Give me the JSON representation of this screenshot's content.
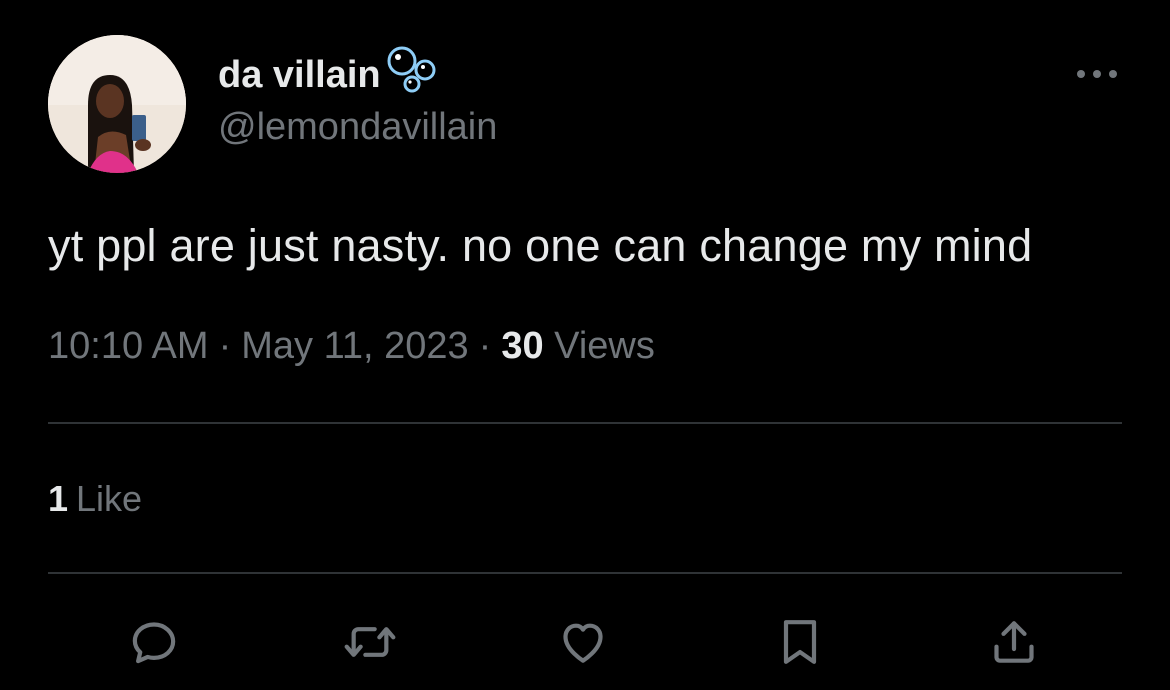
{
  "author": {
    "display_name": "da villain",
    "handle": "@lemondavillain",
    "avatar": "profile-photo",
    "name_emoji": "bubbles-icon"
  },
  "tweet": {
    "text": "yt ppl are just nasty. no one can change my mind",
    "time": "10:10 AM",
    "separator": "·",
    "date": "May 11, 2023",
    "views_count": "30",
    "views_label": "Views"
  },
  "engagement": {
    "likes_count": "1",
    "likes_label": "Like"
  },
  "actions": [
    {
      "icon": "reply-icon"
    },
    {
      "icon": "retweet-icon"
    },
    {
      "icon": "heart-icon"
    },
    {
      "icon": "bookmark-icon"
    },
    {
      "icon": "share-icon"
    }
  ],
  "colors": {
    "background": "#000000",
    "primary_text": "#e7e9ea",
    "secondary_text": "#71767b",
    "divider": "#2f3336"
  }
}
